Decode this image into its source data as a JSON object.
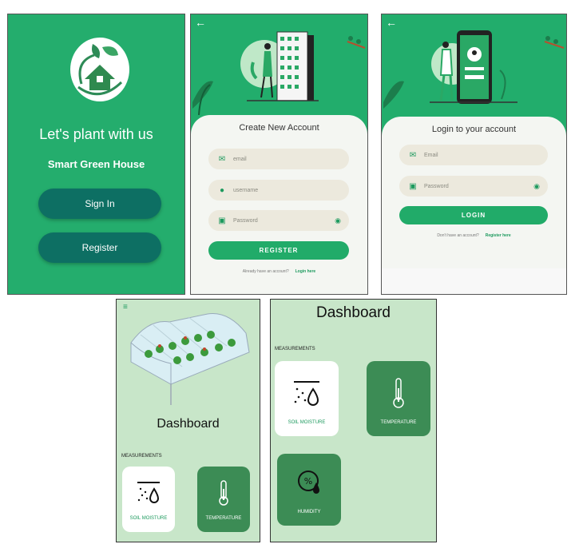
{
  "welcome": {
    "headline": "Let's plant with us",
    "subline": "Smart Green House",
    "sign_in_label": "Sign In",
    "register_label": "Register"
  },
  "create_account": {
    "title": "Create New Account",
    "email_placeholder": "email",
    "username_placeholder": "username",
    "password_placeholder": "Password",
    "submit_label": "REGISTER",
    "footer_text": "Already have an account?",
    "footer_link": "Login here"
  },
  "login": {
    "title": "Login to your account",
    "email_placeholder": "Email",
    "password_placeholder": "Password",
    "submit_label": "LOGIN",
    "footer_text": "Don't have an account?",
    "footer_link": "Register here"
  },
  "dashboard_small": {
    "title": "Dashboard",
    "section": "MEASUREMENTS",
    "tiles": [
      "SOIL MOISTURE",
      "TEMPERATURE"
    ]
  },
  "dashboard_full": {
    "title": "Dashboard",
    "section": "MEASUREMENTS",
    "tiles": [
      "SOIL MOISTURE",
      "TEMPERATURE",
      "HUMIDITY"
    ]
  },
  "colors": {
    "brand_green": "#24ad6d",
    "dark_teal": "#0d6f63",
    "dash_bg": "#c8e6c9",
    "tile_green": "#3c8c55"
  }
}
